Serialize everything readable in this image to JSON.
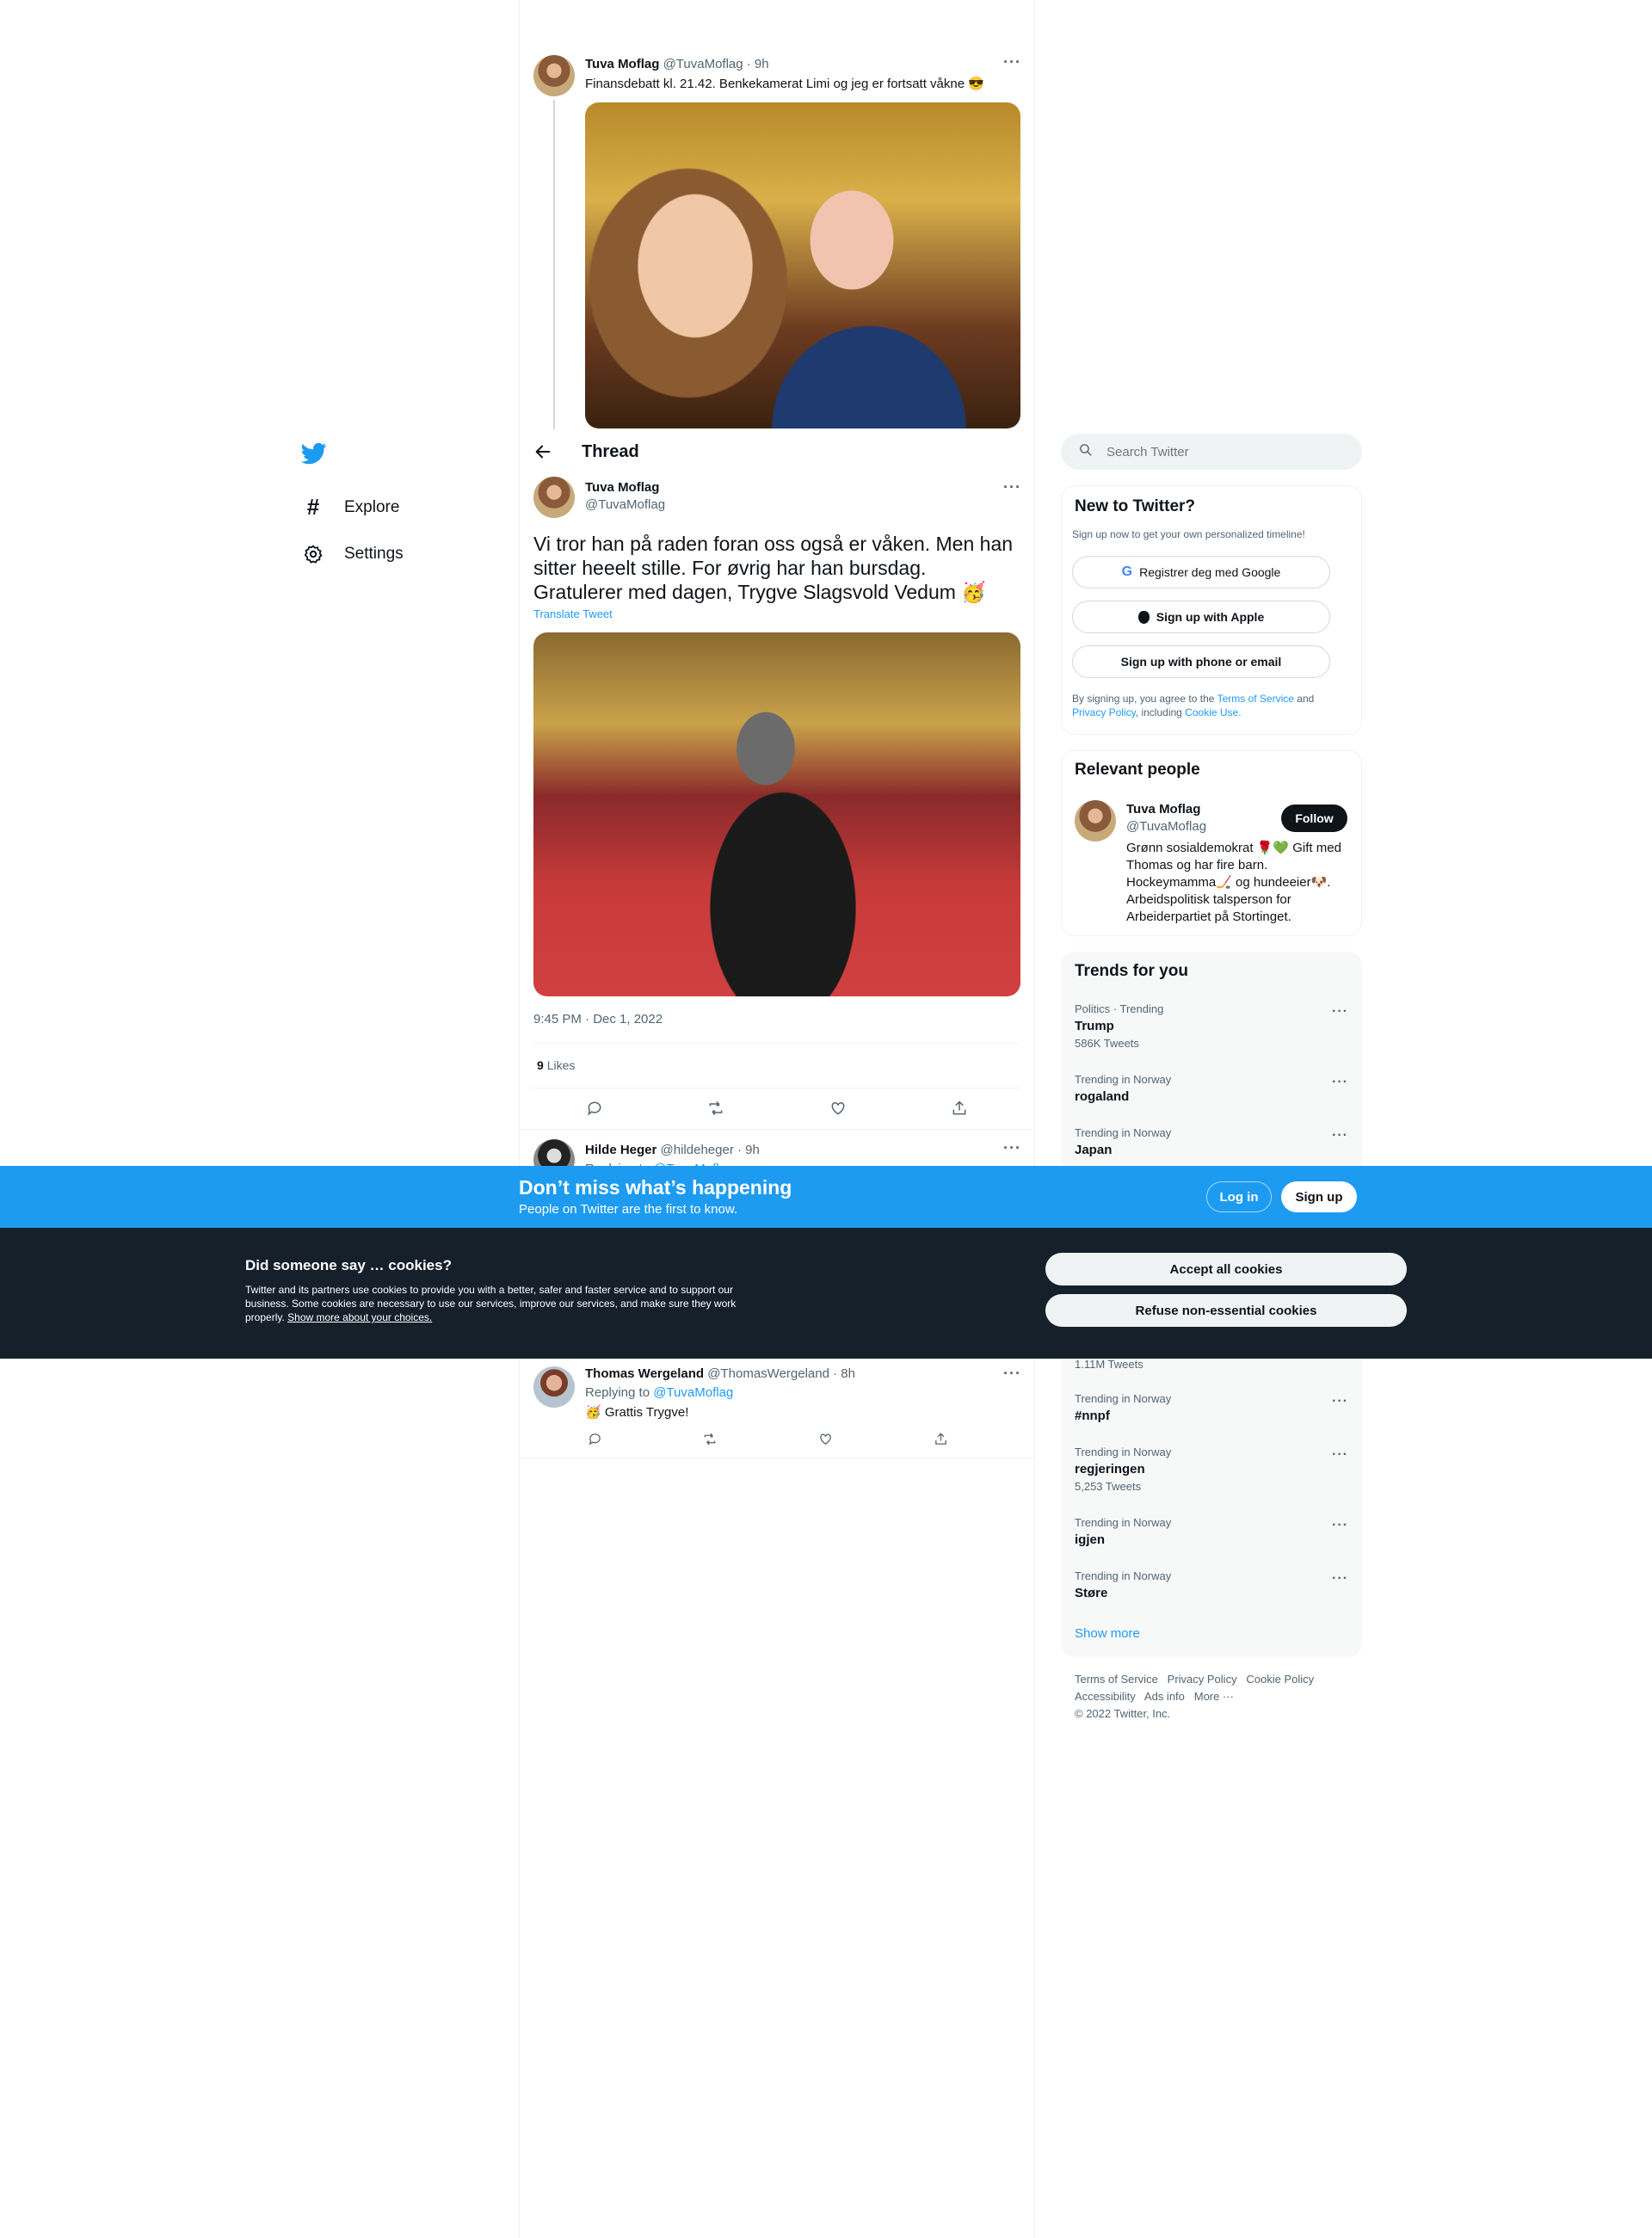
{
  "nav": {
    "items": [
      {
        "label": "Explore",
        "icon": "hashtag-icon"
      },
      {
        "label": "Settings",
        "icon": "gear-icon"
      }
    ]
  },
  "parent_tweet": {
    "name": "Tuva Moflag",
    "handle": "@TuvaMoflag · 9h",
    "text": "Finansdebatt kl. 21.42. Benkekamerat Limi og jeg er fortsatt våkne 😎"
  },
  "thread": {
    "header": "Thread",
    "name": "Tuva Moflag",
    "handle": "@TuvaMoflag",
    "text": "Vi tror han på raden foran oss også er våken. Men han sitter heeelt stille. For øvrig har han bursdag. Gratulerer med dagen, Trygve Slagsvold Vedum 🥳",
    "translate": "Translate Tweet",
    "timestamp": "9:45 PM · Dec 1, 2022",
    "likes_count": "9",
    "likes_label": "Likes"
  },
  "replies": [
    {
      "name": "Hilde Heger",
      "handle": "@hildeheger · 9h",
      "replying_prefix": "Replying to",
      "replying_to": "@TuvaMoflag"
    },
    {
      "name": "Thomas Wergeland",
      "handle": "@ThomasWergeland · 8h",
      "replying_prefix": "Replying to",
      "replying_to": "@TuvaMoflag",
      "text": "🥳 Grattis Trygve!"
    }
  ],
  "search": {
    "placeholder": "Search Twitter"
  },
  "signup": {
    "title": "New to Twitter?",
    "subtitle": "Sign up now to get your own personalized timeline!",
    "google": "Registrer deg med Google",
    "apple": "Sign up with Apple",
    "phone": "Sign up with phone or email",
    "legal_1": "By signing up, you agree to the",
    "tos": "Terms of Service",
    "and": "and",
    "privacy": "Privacy Policy",
    "including": ", including",
    "cookie_use": "Cookie Use."
  },
  "relevant": {
    "title": "Relevant people",
    "name": "Tuva Moflag",
    "handle": "@TuvaMoflag",
    "follow": "Follow",
    "bio": "Grønn sosialdemokrat 🌹💚 Gift med Thomas og har fire barn. Hockeymamma🏒 og hundeeier🐶. Arbeidspolitisk talsperson for Arbeiderpartiet på Stortinget."
  },
  "trends": {
    "title": "Trends for you",
    "items": [
      {
        "category": "Politics · Trending",
        "name": "Trump",
        "count": "586K Tweets"
      },
      {
        "category": "Trending in Norway",
        "name": "rogaland",
        "count": ""
      },
      {
        "category": "Trending in Norway",
        "name": "Japan",
        "count": ""
      },
      {
        "category": "",
        "name": "",
        "count": "1.11M Tweets"
      },
      {
        "category": "Trending in Norway",
        "name": "#nnpf",
        "count": ""
      },
      {
        "category": "Trending in Norway",
        "name": "regjeringen",
        "count": "5,253 Tweets"
      },
      {
        "category": "Trending in Norway",
        "name": "igjen",
        "count": ""
      },
      {
        "category": "Trending in Norway",
        "name": "Støre",
        "count": ""
      }
    ],
    "show_more": "Show more"
  },
  "footer": {
    "links": [
      "Terms of Service",
      "Privacy Policy",
      "Cookie Policy",
      "Accessibility",
      "Ads info",
      "More ···"
    ],
    "copyright": "© 2022 Twitter, Inc."
  },
  "banner": {
    "title": "Don’t miss what’s happening",
    "subtitle": "People on Twitter are the first to know.",
    "login": "Log in",
    "signup": "Sign up"
  },
  "cookies": {
    "title": "Did someone say … cookies?",
    "body": "Twitter and its partners use cookies to provide you with a better, safer and faster service and to support our business. Some cookies are necessary to use our services, improve our services, and make sure they work properly.",
    "link": "Show more about your choices.",
    "accept": "Accept all cookies",
    "refuse": "Refuse non-essential cookies"
  },
  "colors": {
    "accent": "#1d9bf0",
    "dark": "#0f1419",
    "cookie_bg": "#15202b"
  }
}
